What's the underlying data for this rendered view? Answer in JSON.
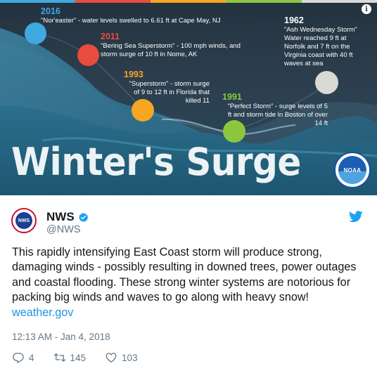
{
  "banner": {
    "strip_colors": [
      "#3fa9e0",
      "#e84c3d",
      "#f5a623",
      "#8cc63f",
      "#d9d9d6"
    ],
    "events": [
      {
        "year": "2016",
        "desc": "\"Nor'easter\" - water levels swelled to 6.61 ft at Cape May, NJ",
        "color": "#3fa9e0"
      },
      {
        "year": "2011",
        "desc": "\"Bering Sea Superstorm\" - 100 mph winds, and storm surge of 10 ft in Nome, AK",
        "color": "#e84c3d"
      },
      {
        "year": "1993",
        "desc": "\"Superstorm\" - storm surge of 9 to 12 ft in Florida that killed 11",
        "color": "#f5a623"
      },
      {
        "year": "1991",
        "desc": "\"Perfect Storm\" - surge levels of 5 ft and storm tide in Boston of over 14 ft",
        "color": "#8cc63f"
      },
      {
        "year": "1962",
        "desc": "\"Ash Wednesday Storm\" Water reached 9 ft at Norfolk and 7 ft on the Virginia coast with 40 ft waves at sea",
        "color": "#d9d9d6"
      }
    ],
    "title": "Winter's Surge",
    "logo_text": "NOAA",
    "info_icon": "i"
  },
  "tweet": {
    "display_name": "NWS",
    "handle": "@NWS",
    "avatar_text": "NWS",
    "text": "This rapidly intensifying East Coast storm will produce strong, damaging winds - possibly resulting in downed trees, power outages and coastal flooding. These strong winter systems are notorious for packing big winds and waves to go along with heavy snow!",
    "link": "weather.gov",
    "timestamp": "12:13 AM - Jan 4, 2018",
    "actions": {
      "replies": "4",
      "retweets": "145",
      "likes": "103"
    },
    "icons": [
      "verified-badge-icon",
      "twitter-bird-icon",
      "reply-icon",
      "retweet-icon",
      "like-icon"
    ],
    "colors": {
      "link": "#1b95e0",
      "meta": "#657786",
      "verified": "#1da1f2"
    }
  }
}
